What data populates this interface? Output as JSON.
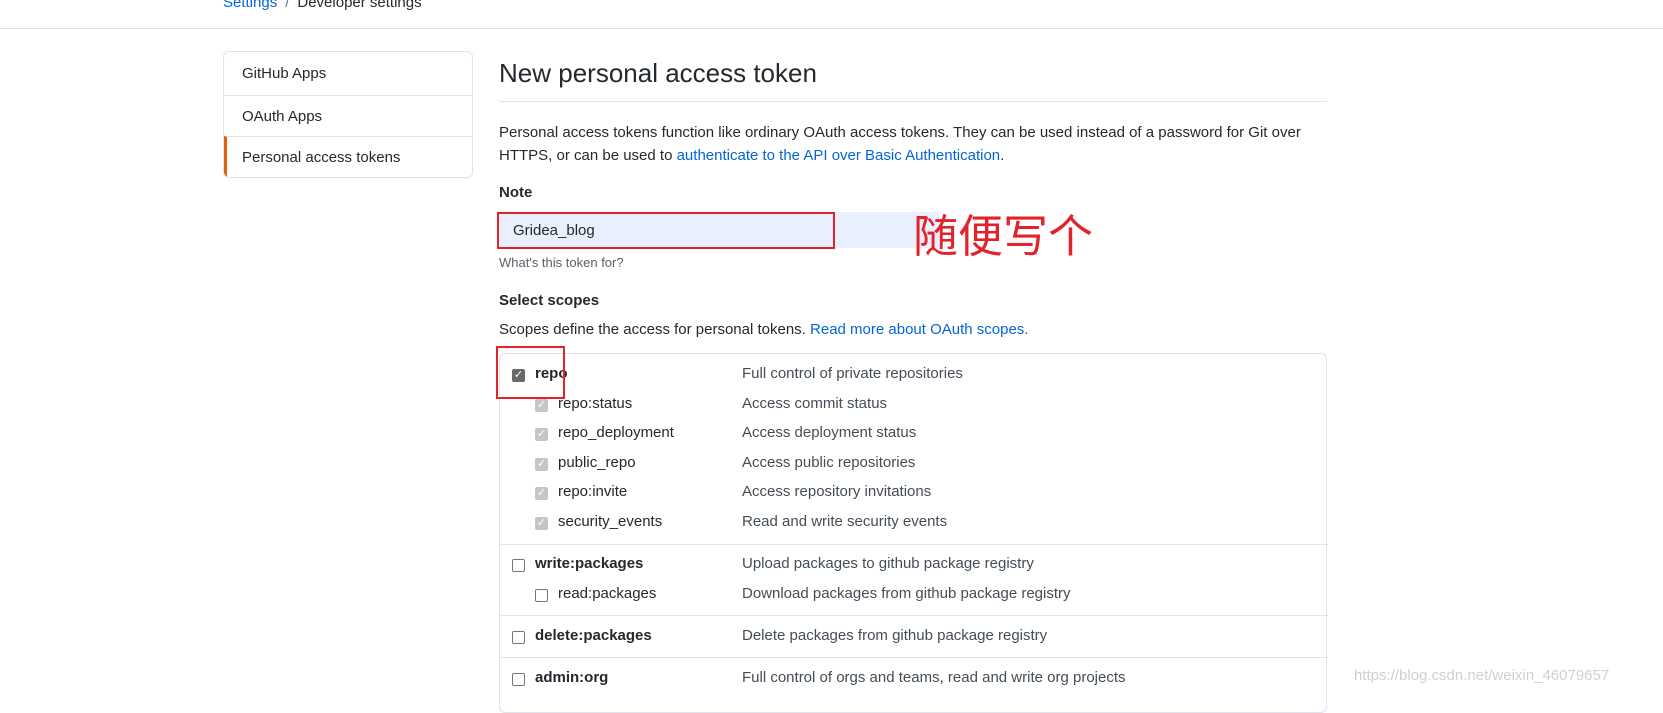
{
  "breadcrumb": {
    "parent": "Settings",
    "separator": "/",
    "current": "Developer settings"
  },
  "sidebar": {
    "items": [
      {
        "label": "GitHub Apps"
      },
      {
        "label": "OAuth Apps"
      },
      {
        "label": "Personal access tokens"
      }
    ]
  },
  "page": {
    "title": "New personal access token",
    "intro_text": "Personal access tokens function like ordinary OAuth access tokens. They can be used instead of a password for Git over HTTPS, or can be used to ",
    "intro_link": "authenticate to the API over Basic Authentication",
    "intro_end": "."
  },
  "note": {
    "label": "Note",
    "value": "Gridea_blog",
    "hint": "What's this token for?"
  },
  "scopes": {
    "label": "Select scopes",
    "description": "Scopes define the access for personal tokens. ",
    "link": "Read more about OAuth scopes.",
    "rows": [
      {
        "name": "repo",
        "desc": "Full control of private repositories",
        "checked": true,
        "child": false
      },
      {
        "name": "repo:status",
        "desc": "Access commit status",
        "checked": true,
        "child": true
      },
      {
        "name": "repo_deployment",
        "desc": "Access deployment status",
        "checked": true,
        "child": true
      },
      {
        "name": "public_repo",
        "desc": "Access public repositories",
        "checked": true,
        "child": true
      },
      {
        "name": "repo:invite",
        "desc": "Access repository invitations",
        "checked": true,
        "child": true
      },
      {
        "name": "security_events",
        "desc": "Read and write security events",
        "checked": true,
        "child": true
      },
      {
        "name": "write:packages",
        "desc": "Upload packages to github package registry",
        "checked": false,
        "child": false
      },
      {
        "name": "read:packages",
        "desc": "Download packages from github package registry",
        "checked": false,
        "child": true
      },
      {
        "name": "delete:packages",
        "desc": "Delete packages from github package registry",
        "checked": false,
        "child": false
      },
      {
        "name": "admin:org",
        "desc": "Full control of orgs and teams, read and write org projects",
        "checked": false,
        "child": false
      }
    ]
  },
  "annotation": {
    "text": "随便写个"
  },
  "watermark": "https://blog.csdn.net/weixin_46079657",
  "colors": {
    "link": "#0366d6",
    "annotation_red": "#e3232c",
    "selected_accent": "#e36209",
    "input_bg": "#e8f0fe"
  }
}
